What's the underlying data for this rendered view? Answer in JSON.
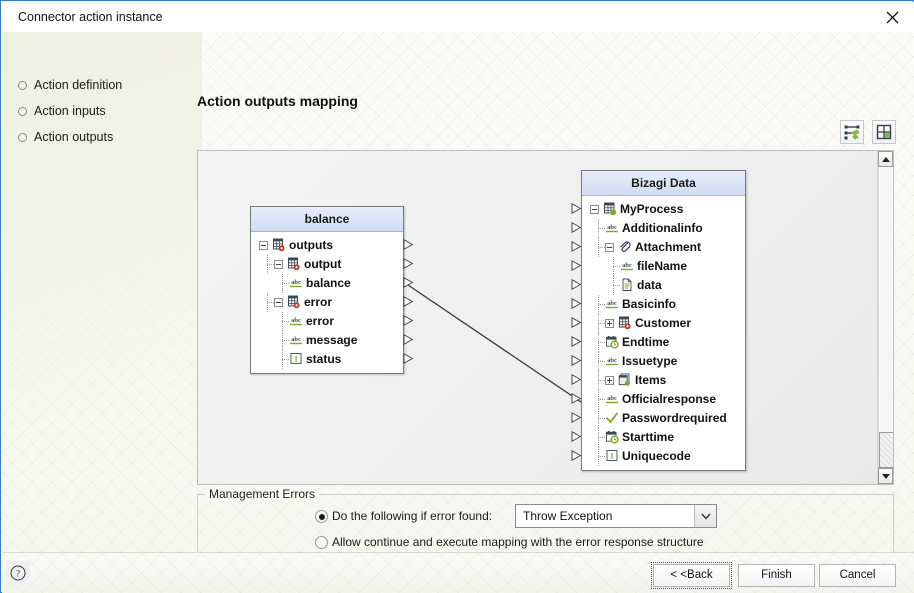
{
  "window": {
    "title": "Connector action instance",
    "close_icon": "close-icon"
  },
  "sidebar": {
    "items": [
      {
        "label": "Action definition",
        "bullet": "diamond-bullet-icon"
      },
      {
        "label": "Action inputs",
        "bullet": "diamond-bullet-icon"
      },
      {
        "label": "Action outputs",
        "bullet": "diamond-bullet-icon"
      }
    ]
  },
  "main": {
    "heading": "Action outputs mapping",
    "toolbar": [
      {
        "name": "auto-map-button",
        "icon": "auto-map-icon",
        "title": "Auto map"
      },
      {
        "name": "arrange-layout-button",
        "icon": "arrange-layout-icon",
        "title": "Arrange"
      }
    ]
  },
  "source_tree": {
    "title": "balance",
    "nodes": [
      {
        "label": "outputs",
        "icon": "table-collection-icon",
        "indent": 0,
        "expander": "minus",
        "port": true
      },
      {
        "label": "output",
        "icon": "table-collection-icon",
        "indent": 1,
        "expander": "minus",
        "port": true
      },
      {
        "label": "balance",
        "icon": "abc-text-icon",
        "indent": 2,
        "expander": "none",
        "port": true
      },
      {
        "label": "error",
        "icon": "table-collection-icon",
        "indent": 1,
        "expander": "minus",
        "port": true
      },
      {
        "label": "error",
        "icon": "abc-text-icon",
        "indent": 2,
        "expander": "none",
        "port": true
      },
      {
        "label": "message",
        "icon": "abc-text-icon",
        "indent": 2,
        "expander": "none",
        "port": true
      },
      {
        "label": "status",
        "icon": "number-one-icon",
        "indent": 2,
        "expander": "none",
        "port": true
      }
    ]
  },
  "target_tree": {
    "title": "Bizagi Data",
    "nodes": [
      {
        "label": "MyProcess",
        "icon": "process-entity-icon",
        "indent": 0,
        "expander": "minus",
        "port": true
      },
      {
        "label": "Additionalinfo",
        "icon": "abc-text-icon",
        "indent": 1,
        "expander": "none",
        "port": true
      },
      {
        "label": "Attachment",
        "icon": "paperclip-icon",
        "indent": 1,
        "expander": "minus",
        "port": true
      },
      {
        "label": "fileName",
        "icon": "abc-text-icon",
        "indent": 2,
        "expander": "none",
        "port": true
      },
      {
        "label": "data",
        "icon": "file-document-icon",
        "indent": 2,
        "expander": "none",
        "port": true
      },
      {
        "label": "Basicinfo",
        "icon": "abc-text-icon",
        "indent": 1,
        "expander": "none",
        "port": true
      },
      {
        "label": "Customer",
        "icon": "table-collection-icon",
        "indent": 1,
        "expander": "plus",
        "port": true
      },
      {
        "label": "Endtime",
        "icon": "calendar-clock-icon",
        "indent": 1,
        "expander": "none",
        "port": true
      },
      {
        "label": "Issuetype",
        "icon": "abc-text-icon",
        "indent": 1,
        "expander": "none",
        "port": true
      },
      {
        "label": "Items",
        "icon": "collection-items-icon",
        "indent": 1,
        "expander": "plus",
        "port": true
      },
      {
        "label": "Officialresponse",
        "icon": "abc-text-icon",
        "indent": 1,
        "expander": "none",
        "port": true
      },
      {
        "label": "Passwordrequired",
        "icon": "check-boolean-icon",
        "indent": 1,
        "expander": "none",
        "port": true
      },
      {
        "label": "Starttime",
        "icon": "calendar-clock-icon",
        "indent": 1,
        "expander": "none",
        "port": true
      },
      {
        "label": "Uniquecode",
        "icon": "number-one-icon",
        "indent": 1,
        "expander": "none",
        "port": true
      }
    ]
  },
  "mapping_links": [
    {
      "from": "balance",
      "to": "Officialresponse"
    }
  ],
  "scrollbar": {
    "up_icon": "scroll-up-arrow-icon",
    "down_icon": "scroll-down-arrow-icon",
    "thumb_position": "bottom"
  },
  "management_errors": {
    "legend": "Management Errors",
    "option_throw": {
      "label": "Do the following if error found:",
      "selected": true
    },
    "option_continue": {
      "label": "Allow continue and execute mapping with the error response structure",
      "selected": false
    },
    "dropdown": {
      "value": "Throw Exception",
      "chevron_icon": "chevron-down-icon"
    }
  },
  "footer": {
    "help_icon": "help-question-icon",
    "buttons": [
      {
        "name": "back-button",
        "label": "< <Back",
        "focused": true
      },
      {
        "name": "finish-button",
        "label": "Finish",
        "focused": false
      },
      {
        "name": "cancel-button",
        "label": "Cancel",
        "focused": false
      }
    ]
  },
  "colors": {
    "window_border": "#2f7fc4",
    "tree_header_top": "#e7eefa",
    "tree_header_bottom": "#cfdcf2",
    "link_line": "#3a3a3a",
    "accent_green": "#7faa28"
  }
}
